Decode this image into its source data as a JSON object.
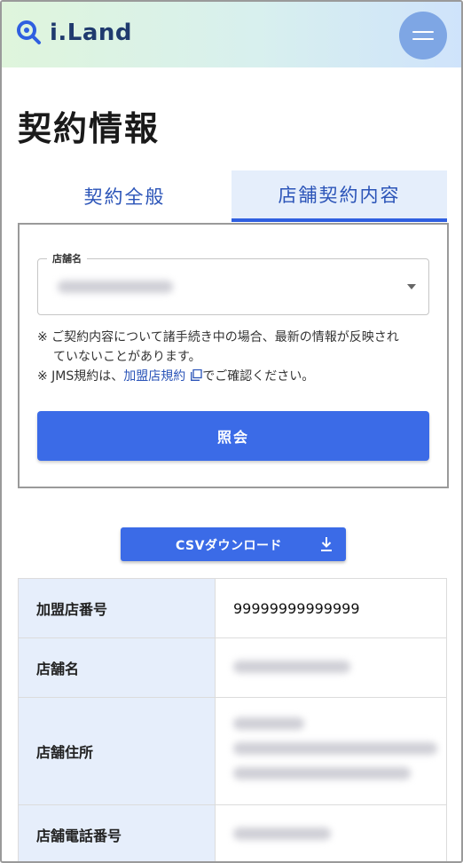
{
  "header": {
    "logo_text": "i.Land",
    "logo_icon": "search-magnifier-logo-icon",
    "menu_icon": "hamburger-menu-icon",
    "gradient_start": "#dff5dc",
    "gradient_end": "#cfe3fb",
    "menu_button_color": "#7ea6e4"
  },
  "page": {
    "title": "契約情報"
  },
  "tabs": [
    {
      "label": "契約全般",
      "active": false
    },
    {
      "label": "店舗契約内容",
      "active": true
    }
  ],
  "form": {
    "store_field_label": "店舗名",
    "store_field_value": "",
    "notes": {
      "line1": "※ ご契約内容について諸手続き中の場合、最新の情報が反映され",
      "line1_cont": "ていないことがあります。",
      "line2_prefix": "※ JMS規約は、",
      "line2_link": "加盟店規約",
      "line2_suffix": "でご確認ください。"
    },
    "submit_label": "照会"
  },
  "csv": {
    "label": "CSVダウンロード"
  },
  "table": {
    "rows": [
      {
        "label": "加盟店番号",
        "value": "99999999999999"
      },
      {
        "label": "店舗名",
        "value": ""
      },
      {
        "label": "店舗住所",
        "value": ""
      },
      {
        "label": "店舗電話番号",
        "value": ""
      }
    ]
  },
  "colors": {
    "accent": "#3b6be7",
    "tab_active_bg": "#e5eefb",
    "table_header_bg": "#e6eefb",
    "link": "#2b54b8"
  }
}
